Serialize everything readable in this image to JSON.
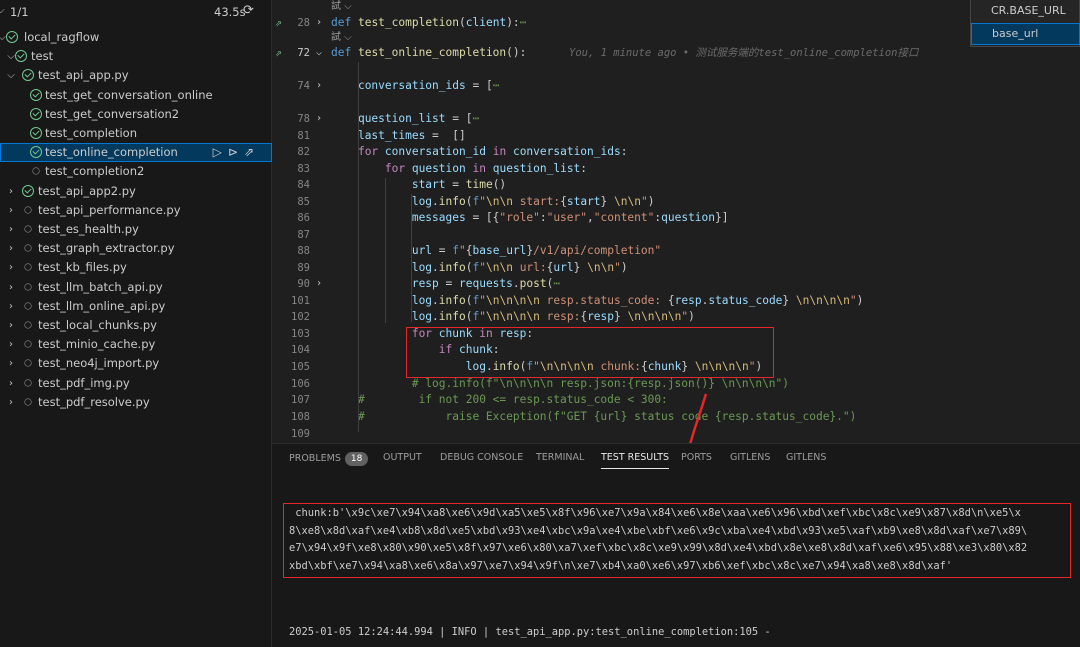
{
  "sidebar": {
    "header": {
      "summary": "1/1",
      "duration": "43.5s",
      "rerun_icon": "rerun-icon"
    },
    "tree": [
      {
        "label": "local_ragflow",
        "chevron": "⌵",
        "status": "pass",
        "level": 0
      },
      {
        "label": "test",
        "chevron": "⌵",
        "status": "pass",
        "level": 1
      },
      {
        "label": "test_api_app.py",
        "chevron": "⌵",
        "status": "pass",
        "level": 2
      },
      {
        "label": "test_get_conversation_online",
        "chevron": "",
        "status": "pass",
        "level": 3
      },
      {
        "label": "test_get_conversation2",
        "chevron": "",
        "status": "pass",
        "level": 3
      },
      {
        "label": "test_completion",
        "chevron": "",
        "status": "pass",
        "level": 3
      },
      {
        "label": "test_online_completion",
        "chevron": "",
        "status": "pass",
        "level": 3,
        "selected": true
      },
      {
        "label": "test_completion2",
        "chevron": "",
        "status": "none",
        "level": 3
      },
      {
        "label": "test_api_app2.py",
        "chevron": "›",
        "status": "pass",
        "level": 2
      },
      {
        "label": "test_api_performance.py",
        "chevron": "›",
        "status": "none",
        "level": 2
      },
      {
        "label": "test_es_health.py",
        "chevron": "›",
        "status": "none",
        "level": 2
      },
      {
        "label": "test_graph_extractor.py",
        "chevron": "›",
        "status": "none",
        "level": 2
      },
      {
        "label": "test_kb_files.py",
        "chevron": "›",
        "status": "none",
        "level": 2
      },
      {
        "label": "test_llm_batch_api.py",
        "chevron": "›",
        "status": "none",
        "level": 2
      },
      {
        "label": "test_llm_online_api.py",
        "chevron": "›",
        "status": "none",
        "level": 2
      },
      {
        "label": "test_local_chunks.py",
        "chevron": "›",
        "status": "none",
        "level": 2
      },
      {
        "label": "test_minio_cache.py",
        "chevron": "›",
        "status": "none",
        "level": 2
      },
      {
        "label": "test_neo4j_import.py",
        "chevron": "›",
        "status": "none",
        "level": 2
      },
      {
        "label": "test_pdf_img.py",
        "chevron": "›",
        "status": "none",
        "level": 2
      },
      {
        "label": "test_pdf_resolve.py",
        "chevron": "›",
        "status": "none",
        "level": 2
      }
    ],
    "row_actions": [
      "run-test-icon",
      "debug-test-icon",
      "go-to-test-icon"
    ]
  },
  "suggest": {
    "items": [
      "CR.BASE_URL",
      "base_url"
    ],
    "selected": 1
  },
  "editor": {
    "codelens_1": "試 ⌵",
    "codelens_2": "試 ⌵",
    "blame": "You, 1 minute ago • 测试服务端的test_online_completion接口",
    "lines": [
      {
        "n": "28",
        "fold": "›",
        "run": true,
        "html": "<span class='k'>def</span> <span class='f'>test_completion</span>(<span class='v'>client</span>):<span class='c'>⋯</span>"
      },
      {
        "n": "72",
        "fold": "⌵",
        "run": true,
        "cur": true,
        "html": "<span class='k'>def</span> <span class='f'>test_online_completion</span>():"
      },
      {
        "n": "",
        "html": ""
      },
      {
        "n": "74",
        "fold": "›",
        "html": "    <span class='v'>conversation_ids</span> = [<span class='c'>⋯</span>"
      },
      {
        "n": "",
        "html": ""
      },
      {
        "n": "78",
        "fold": "›",
        "html": "    <span class='v'>question_list</span> = [<span class='c'>⋯</span>"
      },
      {
        "n": "81",
        "html": "    <span class='v'>last_times</span> =  []"
      },
      {
        "n": "82",
        "html": "    <span class='kf'>for</span> <span class='v'>conversation_id</span> <span class='kf'>in</span> <span class='v'>conversation_ids</span>:"
      },
      {
        "n": "83",
        "html": "        <span class='kf'>for</span> <span class='v'>question</span> <span class='kf'>in</span> <span class='v'>question_list</span>:"
      },
      {
        "n": "84",
        "html": "            <span class='v'>start</span> = <span class='f'>time</span>()"
      },
      {
        "n": "85",
        "html": "            <span class='v'>log</span>.<span class='f'>info</span>(<span class='fp'>f</span><span class='s'>\"<span class='b'>\\n\\n</span> start:</span>{<span class='v'>start</span>}<span class='s'> <span class='b'>\\n\\n</span>\"</span>)"
      },
      {
        "n": "86",
        "html": "            <span class='v'>messages</span> = [{<span class='s'>\"role\"</span>:<span class='s'>\"user\"</span>,<span class='s'>\"content\"</span>:<span class='v'>question</span>}]"
      },
      {
        "n": "87",
        "html": ""
      },
      {
        "n": "88",
        "html": "            <span class='v'>url</span> = <span class='fp'>f</span><span class='s'>\"</span>{<span class='v'>base_url</span>}<span class='s'>/v1/api/completion\"</span>"
      },
      {
        "n": "89",
        "html": "            <span class='v'>log</span>.<span class='f'>info</span>(<span class='fp'>f</span><span class='s'>\"<span class='b'>\\n\\n</span> url:</span>{<span class='v'>url</span>}<span class='s'> <span class='b'>\\n\\n</span>\"</span>)"
      },
      {
        "n": "90",
        "fold": "›",
        "html": "            <span class='v'>resp</span> = <span class='v'>requests</span>.<span class='f'>post</span>(<span class='c'>⋯</span>"
      },
      {
        "n": "101",
        "html": "            <span class='v'>log</span>.<span class='f'>info</span>(<span class='fp'>f</span><span class='s'>\"<span class='b'>\\n\\n\\n\\n</span> resp.status_code: </span>{<span class='v'>resp</span>.<span class='v'>status_code</span>}<span class='s'> <span class='b'>\\n\\n\\n\\n</span>\"</span>)"
      },
      {
        "n": "102",
        "html": "            <span class='v'>log</span>.<span class='f'>info</span>(<span class='fp'>f</span><span class='s'>\"<span class='b'>\\n\\n\\n\\n</span> resp:</span>{<span class='v'>resp</span>}<span class='s'> <span class='b'>\\n\\n\\n\\n</span>\"</span>)"
      },
      {
        "n": "103",
        "html": "            <span class='kf'>for</span> <span class='v'>chunk</span> <span class='kf'>in</span> <span class='v'>resp</span>:"
      },
      {
        "n": "104",
        "html": "                <span class='kf'>if</span> <span class='v'>chunk</span>:"
      },
      {
        "n": "105",
        "html": "                    <span class='v'>log</span>.<span class='f'>info</span>(<span class='fp'>f</span><span class='s'>\"<span class='b'>\\n\\n\\n\\n</span> chunk:</span>{<span class='v'>chunk</span>}<span class='s'> <span class='b'>\\n\\n\\n\\n</span>\"</span>)"
      },
      {
        "n": "106",
        "html": "            <span class='c'># log.info(f\"\\n\\n\\n\\n resp.json:{resp.json()} \\n\\n\\n\\n\")</span>"
      },
      {
        "n": "107",
        "html": "    <span class='c'>#        if not 200 &lt;= resp.status_code &lt; 300:</span>"
      },
      {
        "n": "108",
        "html": "    <span class='c'>#            raise Exception(f\"GET {url} status code {resp.status_code}.\")</span>"
      },
      {
        "n": "109",
        "html": ""
      }
    ]
  },
  "panel": {
    "tabs": [
      {
        "label": "PROBLEMS",
        "badge": "18"
      },
      {
        "label": "OUTPUT"
      },
      {
        "label": "DEBUG CONSOLE"
      },
      {
        "label": "TERMINAL"
      },
      {
        "label": "TEST RESULTS",
        "active": true
      },
      {
        "label": "PORTS"
      },
      {
        "label": "GITLENS"
      },
      {
        "label": "GITLENS"
      }
    ],
    "output_lines": [
      " chunk:b'\\x9c\\xe7\\x94\\xa8\\xe6\\x9d\\xa5\\xe5\\x8f\\x96\\xe7\\x9a\\x84\\xe6\\x8e\\xaa\\xe6\\x96\\xbd\\xef\\xbc\\x8c\\xe9\\x87\\x8d\\n\\xe5\\x",
      "8\\xe8\\x8d\\xaf\\xe4\\xb8\\x8d\\xe5\\xbd\\x93\\xe4\\xbc\\x9a\\xe4\\xbe\\xbf\\xe6\\x9c\\xba\\xe4\\xbd\\x93\\xe5\\xaf\\xb9\\xe8\\x8d\\xaf\\xe7\\x89\\",
      "e7\\x94\\x9f\\xe8\\x80\\x90\\xe5\\x8f\\x97\\xe6\\x80\\xa7\\xef\\xbc\\x8c\\xe9\\x99\\x8d\\xe4\\xbd\\x8e\\xe8\\x8d\\xaf\\xe6\\x95\\x88\\xe3\\x80\\x82",
      "xbd\\xbf\\xe7\\x94\\xa8\\xe6\\x8a\\x97\\xe7\\x94\\x9f\\n\\xe7\\xb4\\xa0\\xe6\\x97\\xb6\\xef\\xbc\\x8c\\xe7\\x94\\xa8\\xe8\\x8d\\xaf'"
    ],
    "log_line": "2025-01-05 12:24:44.994 | INFO | test_api_app.py:test_online_completion:105 -"
  },
  "colors": {
    "highlight": "#e5262b",
    "pass": "#73c991",
    "selection": "#04395e"
  }
}
